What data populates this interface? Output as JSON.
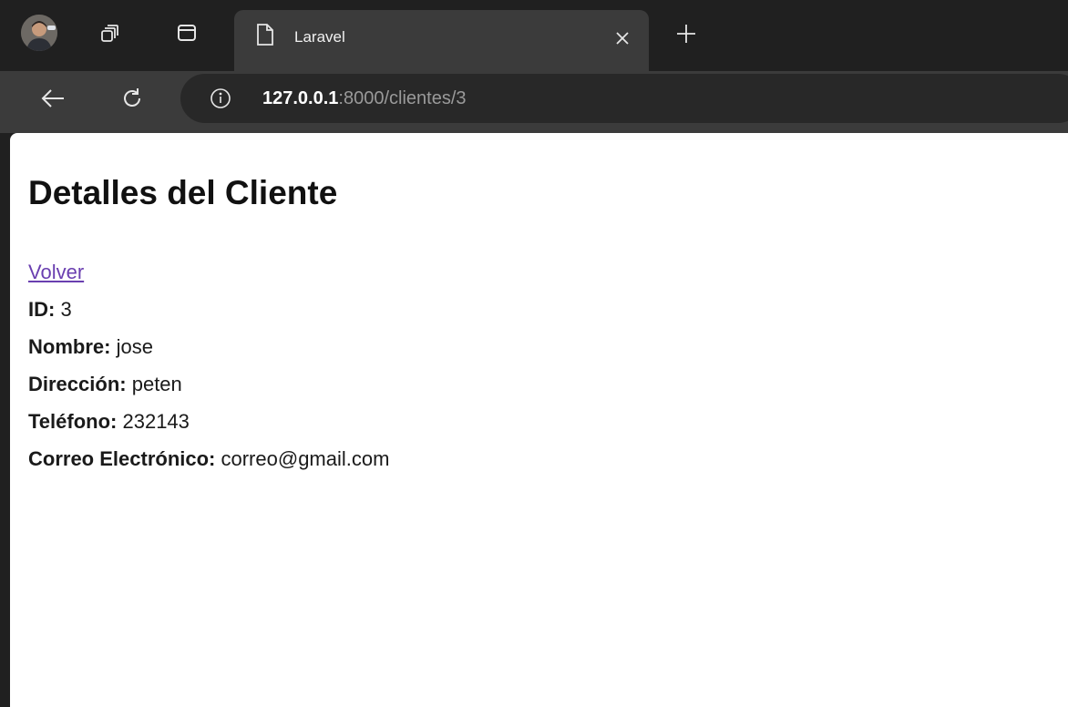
{
  "browser": {
    "tab": {
      "title": "Laravel",
      "close_glyph": "×"
    },
    "newtab_glyph": "+",
    "address": {
      "host": "127.0.0.1",
      "rest": ":8000/clientes/3"
    },
    "icons": {
      "profile": "profile-avatar",
      "workspaces": "workspaces-icon",
      "tab_actions": "tab-actions-icon",
      "page": "page-icon",
      "back": "back-arrow-icon",
      "reload": "reload-icon",
      "info": "info-icon"
    }
  },
  "page": {
    "title": "Detalles del Cliente",
    "back_link": "Volver",
    "details": [
      {
        "label": "ID:",
        "value": "3"
      },
      {
        "label": "Nombre:",
        "value": "jose"
      },
      {
        "label": "Dirección:",
        "value": "peten"
      },
      {
        "label": "Teléfono:",
        "value": "232143"
      },
      {
        "label": "Correo Electrónico:",
        "value": "correo@gmail.com"
      }
    ]
  },
  "colors": {
    "chrome_dark": "#202020",
    "chrome_toolbar": "#3b3b3b",
    "omnibox": "#282828",
    "link": "#6a3fb0",
    "page_bg": "#ffffff"
  }
}
